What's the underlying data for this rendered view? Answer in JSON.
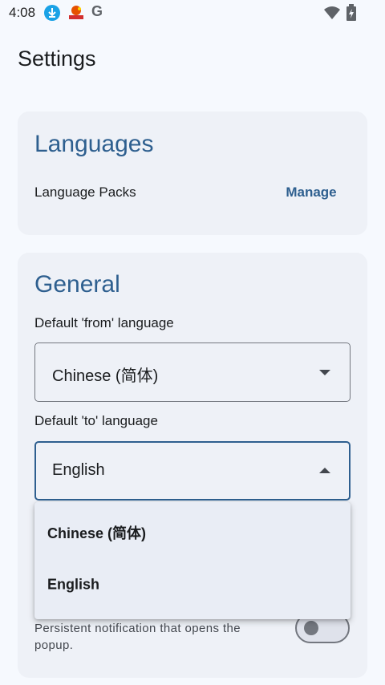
{
  "status_bar": {
    "time": "4:08",
    "icons": [
      "download-icon",
      "flag-icon",
      "google-icon",
      "wifi-icon",
      "battery-icon"
    ],
    "google_letter": "G"
  },
  "page": {
    "title": "Settings"
  },
  "languages_card": {
    "heading": "Languages",
    "language_packs_label": "Language Packs",
    "manage_label": "Manage"
  },
  "general_card": {
    "heading": "General",
    "from_label": "Default 'from' language",
    "from_value": "Chinese (简体)",
    "to_label": "Default 'to' language",
    "to_value": "English",
    "notification_text": "Persistent notification that opens the popup.",
    "notification_toggle_on": false
  },
  "dropdown": {
    "options": [
      "Chinese (简体)",
      "English"
    ]
  },
  "colors": {
    "accent": "#2e5f8f",
    "background": "#f6f9fe",
    "card": "#eef1f7",
    "menu": "#e9edf5"
  }
}
